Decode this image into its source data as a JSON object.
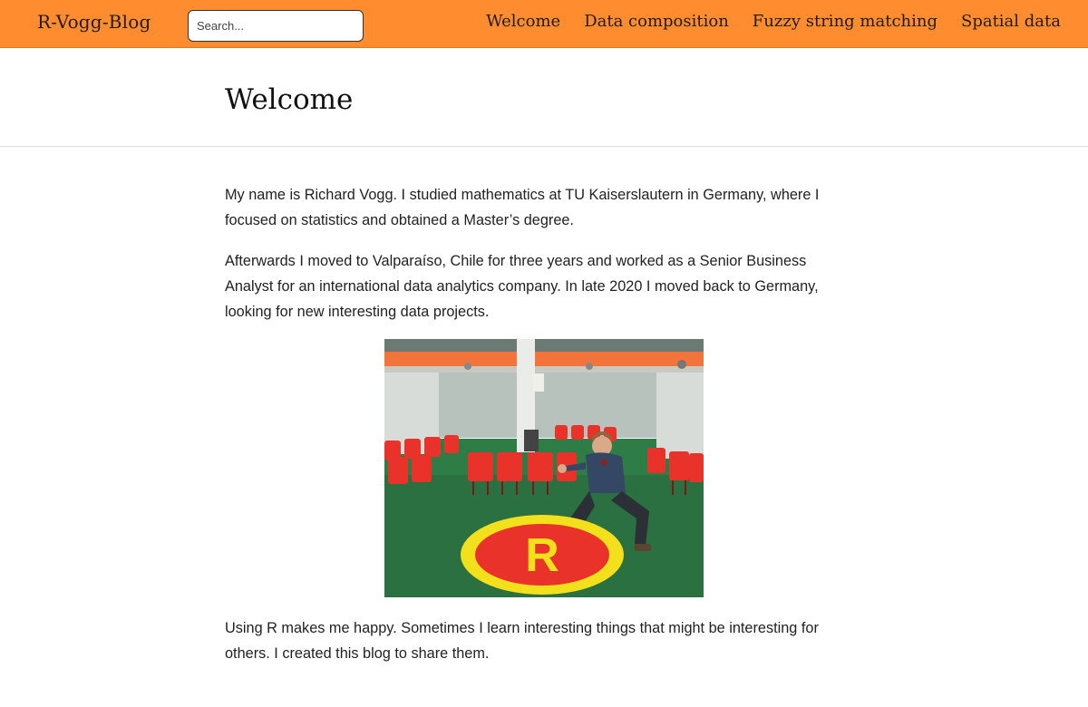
{
  "navbar": {
    "brand": "R-Vogg-Blog",
    "search_placeholder": "Search...",
    "links": [
      "Welcome",
      "Data composition",
      "Fuzzy string matching",
      "Spatial data"
    ]
  },
  "page": {
    "title": "Welcome",
    "paragraphs": [
      "My name is Richard Vogg. I studied mathematics at TU Kaiserslautern in Germany, where I focused on statistics and obtained a Master’s degree.",
      "Afterwards I moved to Valparaíso, Chile for three years and worked as a Senior Business Analyst for an international data analytics company. In late 2020 I moved back to Germany, looking for new interesting data projects.",
      "Using R makes me happy. Sometimes I learn interesting things that might be interesting for others. I created this blog to share them."
    ],
    "photo_letter": "R"
  },
  "colors": {
    "navbar": "#ff8c2e",
    "photo_deck": "#2e7d46",
    "photo_chairs": "#e8322a",
    "photo_roof": "#f2743a",
    "photo_circle_outer": "#f2e01c"
  },
  "icons": {}
}
